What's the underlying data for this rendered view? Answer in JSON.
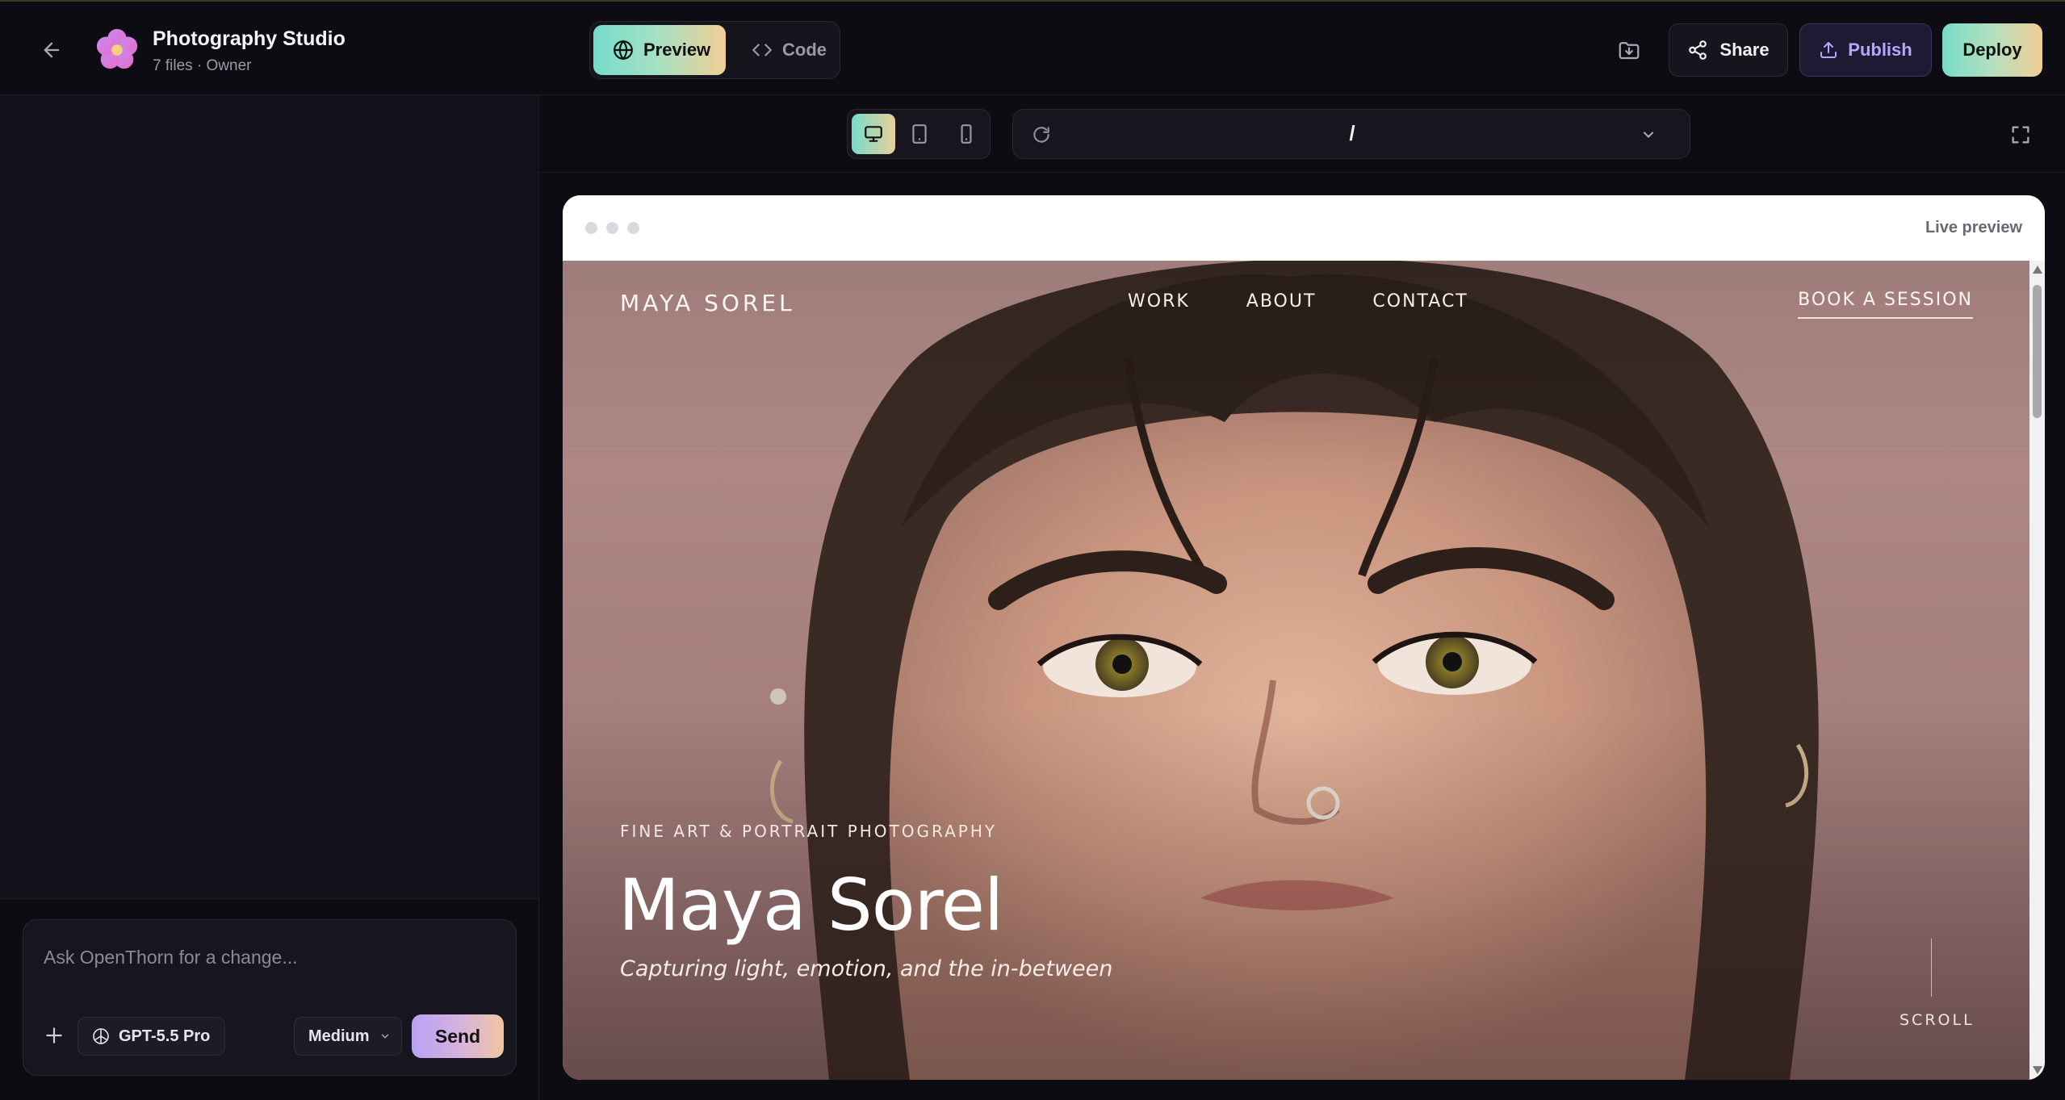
{
  "header": {
    "project_title": "Photography Studio",
    "project_meta": "7 files · Owner",
    "modes": {
      "preview_label": "Preview",
      "code_label": "Code",
      "active": "Preview"
    },
    "share_label": "Share",
    "publish_label": "Publish",
    "deploy_label": "Deploy"
  },
  "chat": {
    "placeholder": "Ask OpenThorn for a change...",
    "model_label": "GPT-5.5 Pro",
    "effort_label": "Medium",
    "send_label": "Send"
  },
  "preview": {
    "active_device": "desktop",
    "route": "/",
    "frame_label": "Live preview"
  },
  "site": {
    "logo": "MAYA SOREL",
    "nav": [
      "WORK",
      "ABOUT",
      "CONTACT"
    ],
    "cta": "BOOK A SESSION",
    "kicker": "FINE ART & PORTRAIT PHOTOGRAPHY",
    "title": "Maya Sorel",
    "subtitle": "Capturing light, emotion, and the in-between",
    "scroll_label": "SCROLL"
  },
  "colors": {
    "background": "#0d0c12",
    "panel": "#121119",
    "accent_gradient_start": "#74dccb",
    "accent_gradient_end": "#f0cf96",
    "publish_text": "#b6a6ff",
    "send_gradient_start": "#b9a1f3"
  },
  "icons": {
    "back": "arrow-left-icon",
    "logo": "flower-logo-icon",
    "preview": "globe-icon",
    "code": "code-brackets-icon",
    "download": "folder-download-icon",
    "share": "share-nodes-icon",
    "publish": "upload-icon",
    "attach": "plus-icon",
    "model": "openai-icon",
    "devices": [
      "desktop-icon",
      "tablet-icon",
      "mobile-icon"
    ],
    "refresh": "refresh-icon",
    "route_dropdown": "chevron-down-icon",
    "fullscreen": "fullscreen-icon"
  }
}
